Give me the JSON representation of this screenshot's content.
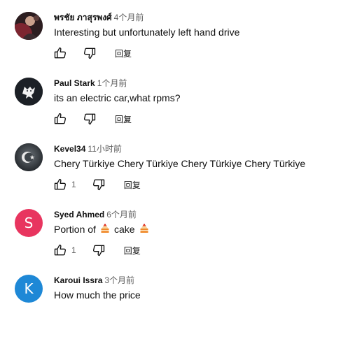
{
  "colors": {
    "avatar_s": "#e8355f",
    "avatar_k": "#1e88d6",
    "icon_stroke": "#0f0f0f",
    "secondary_text": "#606060"
  },
  "comments": [
    {
      "author": "พรชัย ภาสุรพงศ์",
      "time": "4个月前",
      "text": "Interesting but unfortunately left hand drive",
      "likes": "",
      "reply_label": "回复",
      "avatar": "photo"
    },
    {
      "author": "Paul Stark",
      "time": "1个月前",
      "text": "its an electric car,what rpms?",
      "likes": "",
      "reply_label": "回复",
      "avatar": "wolf-logo"
    },
    {
      "author": "Kevel34",
      "time": "11小时前",
      "text": "Chery Türkiye Chery Türkiye Chery Türkiye Chery Türkiye",
      "likes": "1",
      "reply_label": "回复",
      "avatar": "crescent-star"
    },
    {
      "author": "Syed Ahmed",
      "time": "6个月前",
      "text_before": "Portion of",
      "text_middle": "cake",
      "likes": "1",
      "reply_label": "回复",
      "avatar_letter": "S"
    },
    {
      "author": "Karoui Issra",
      "time": "3个月前",
      "text": "How much the price",
      "avatar_letter": "K"
    }
  ]
}
